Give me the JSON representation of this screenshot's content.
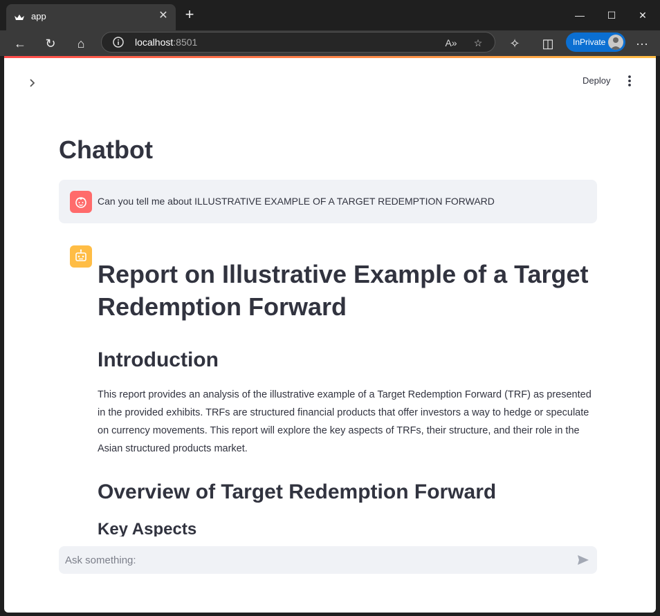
{
  "browser": {
    "tab_title": "app",
    "address_host": "localhost",
    "address_port": ":8501",
    "inprivate_label": "InPrivate",
    "icons": [
      "back-icon",
      "refresh-icon",
      "home-icon",
      "info-icon",
      "read-aloud-icon",
      "favorite-star-icon",
      "extensions-icon",
      "split-screen-icon",
      "more-icon"
    ]
  },
  "app": {
    "deploy_label": "Deploy",
    "title": "Chatbot",
    "user_message": "Can you tell me about ILLUSTRATIVE EXAMPLE OF A TARGET REDEMPTION FORWARD",
    "assistant": {
      "heading": "Report on Illustrative Example of a Target Redemption Forward",
      "intro_heading": "Introduction",
      "intro_paragraph": "This report provides an analysis of the illustrative example of a Target Redemption Forward (TRF) as presented in the provided exhibits. TRFs are structured financial products that offer investors a way to hedge or speculate on currency movements. This report will explore the key aspects of TRFs, their structure, and their role in the Asian structured products market.",
      "overview_heading": "Overview of Target Redemption Forward",
      "key_aspects_heading": "Key Aspects"
    },
    "chat_input_placeholder": "Ask something:",
    "colors": {
      "user_avatar": "#ff6b6b",
      "bot_avatar": "#ffbd45",
      "message_bg": "#f0f2f6",
      "text": "#31333f"
    }
  }
}
